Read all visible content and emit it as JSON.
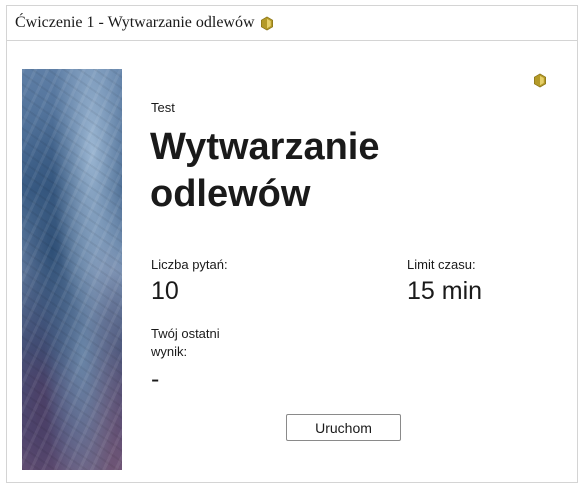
{
  "header": {
    "title": "Ćwiczenie 1 - Wytwarzanie odlewów",
    "icon": "hexagon-icon"
  },
  "activity": {
    "kind": "Test",
    "title": "Wytwarzanie odlewów",
    "corner_icon": "hexagon-icon",
    "questions_label": "Liczba pytań:",
    "questions_value": "10",
    "time_label": "Limit czasu:",
    "time_value": "15 min",
    "result_label": "Twój ostatni wynik:",
    "result_value": "-",
    "start_label": "Uruchom"
  },
  "colors": {
    "hex_fill": "#b49a28",
    "hex_light": "#e6d06a",
    "border": "#d4d4d4"
  }
}
